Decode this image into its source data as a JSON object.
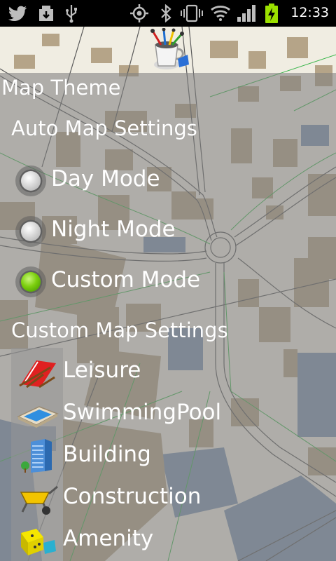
{
  "status_bar": {
    "time": "12:33",
    "icons": [
      "twitter-icon",
      "download-icon",
      "usb-icon",
      "gps-icon",
      "bluetooth-icon",
      "vibrate-icon",
      "wifi-icon",
      "signal-icon",
      "battery-charging-icon"
    ]
  },
  "header": {
    "icon": "paint-brushes-cup-icon",
    "title": "Map Theme"
  },
  "auto_settings": {
    "title": "Auto Map Settings",
    "options": [
      {
        "label": "Day Mode",
        "checked": false
      },
      {
        "label": "Night Mode",
        "checked": false
      },
      {
        "label": "Custom Mode",
        "checked": true
      }
    ]
  },
  "custom_settings": {
    "title": "Custom Map Settings",
    "items": [
      {
        "label": "Leisure",
        "icon": "beach-chair-icon"
      },
      {
        "label": "SwimmingPool",
        "icon": "swimming-pool-icon"
      },
      {
        "label": "Building",
        "icon": "building-icon"
      },
      {
        "label": "Construction",
        "icon": "wheelbarrow-icon"
      },
      {
        "label": "Amenity",
        "icon": "dice-icon"
      }
    ]
  },
  "colors": {
    "checked_radio": "#7ccf0e",
    "overlay": "#808080",
    "map_building": "#b7a58a",
    "map_water": "#7e95b2",
    "map_road_outline": "#5a5a5a",
    "map_boundary": "#39b54a"
  }
}
